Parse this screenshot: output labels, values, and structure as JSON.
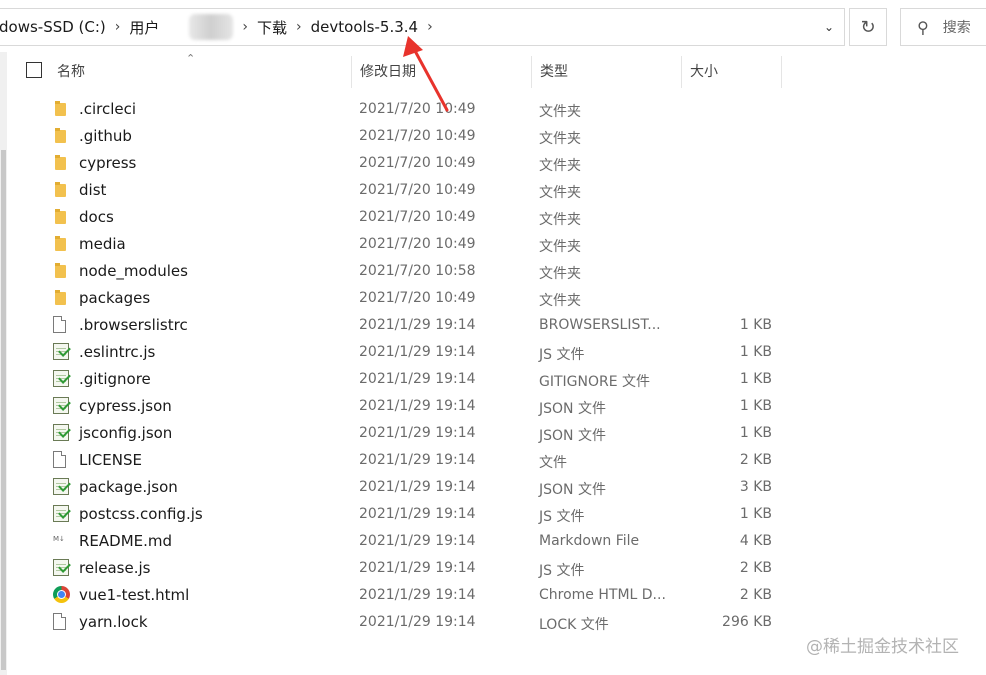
{
  "address_bar": {
    "drive": "dows-SSD (C:)",
    "users": "用户",
    "downloads": "下载",
    "current_folder": "devtools-5.3.4",
    "dropdown_icon": "chevron-down-icon"
  },
  "search": {
    "placeholder": "搜索"
  },
  "columns": {
    "name": "名称",
    "date_modified": "修改日期",
    "type": "类型",
    "size": "大小"
  },
  "files": [
    {
      "name": ".circleci",
      "date": "2021/7/20 10:49",
      "type": "文件夹",
      "size": "",
      "icon": "folder"
    },
    {
      "name": ".github",
      "date": "2021/7/20 10:49",
      "type": "文件夹",
      "size": "",
      "icon": "folder"
    },
    {
      "name": "cypress",
      "date": "2021/7/20 10:49",
      "type": "文件夹",
      "size": "",
      "icon": "folder"
    },
    {
      "name": "dist",
      "date": "2021/7/20 10:49",
      "type": "文件夹",
      "size": "",
      "icon": "folder"
    },
    {
      "name": "docs",
      "date": "2021/7/20 10:49",
      "type": "文件夹",
      "size": "",
      "icon": "folder"
    },
    {
      "name": "media",
      "date": "2021/7/20 10:49",
      "type": "文件夹",
      "size": "",
      "icon": "folder"
    },
    {
      "name": "node_modules",
      "date": "2021/7/20 10:58",
      "type": "文件夹",
      "size": "",
      "icon": "folder"
    },
    {
      "name": "packages",
      "date": "2021/7/20 10:49",
      "type": "文件夹",
      "size": "",
      "icon": "folder"
    },
    {
      "name": ".browserslistrc",
      "date": "2021/1/29 19:14",
      "type": "BROWSERSLIST...",
      "size": "1 KB",
      "icon": "file"
    },
    {
      "name": ".eslintrc.js",
      "date": "2021/1/29 19:14",
      "type": "JS 文件",
      "size": "1 KB",
      "icon": "script"
    },
    {
      "name": ".gitignore",
      "date": "2021/1/29 19:14",
      "type": "GITIGNORE 文件",
      "size": "1 KB",
      "icon": "script"
    },
    {
      "name": "cypress.json",
      "date": "2021/1/29 19:14",
      "type": "JSON 文件",
      "size": "1 KB",
      "icon": "script"
    },
    {
      "name": "jsconfig.json",
      "date": "2021/1/29 19:14",
      "type": "JSON 文件",
      "size": "1 KB",
      "icon": "script"
    },
    {
      "name": "LICENSE",
      "date": "2021/1/29 19:14",
      "type": "文件",
      "size": "2 KB",
      "icon": "file"
    },
    {
      "name": "package.json",
      "date": "2021/1/29 19:14",
      "type": "JSON 文件",
      "size": "3 KB",
      "icon": "script"
    },
    {
      "name": "postcss.config.js",
      "date": "2021/1/29 19:14",
      "type": "JS 文件",
      "size": "1 KB",
      "icon": "script"
    },
    {
      "name": "README.md",
      "date": "2021/1/29 19:14",
      "type": "Markdown File",
      "size": "4 KB",
      "icon": "md"
    },
    {
      "name": "release.js",
      "date": "2021/1/29 19:14",
      "type": "JS 文件",
      "size": "2 KB",
      "icon": "script"
    },
    {
      "name": "vue1-test.html",
      "date": "2021/1/29 19:14",
      "type": "Chrome HTML D...",
      "size": "2 KB",
      "icon": "chrome"
    },
    {
      "name": "yarn.lock",
      "date": "2021/1/29 19:14",
      "type": "LOCK 文件",
      "size": "296 KB",
      "icon": "file"
    }
  ],
  "watermark": "@稀土掘金技术社区",
  "colors": {
    "annotation_arrow": "#e8332c",
    "folder": "#f2c14e"
  }
}
